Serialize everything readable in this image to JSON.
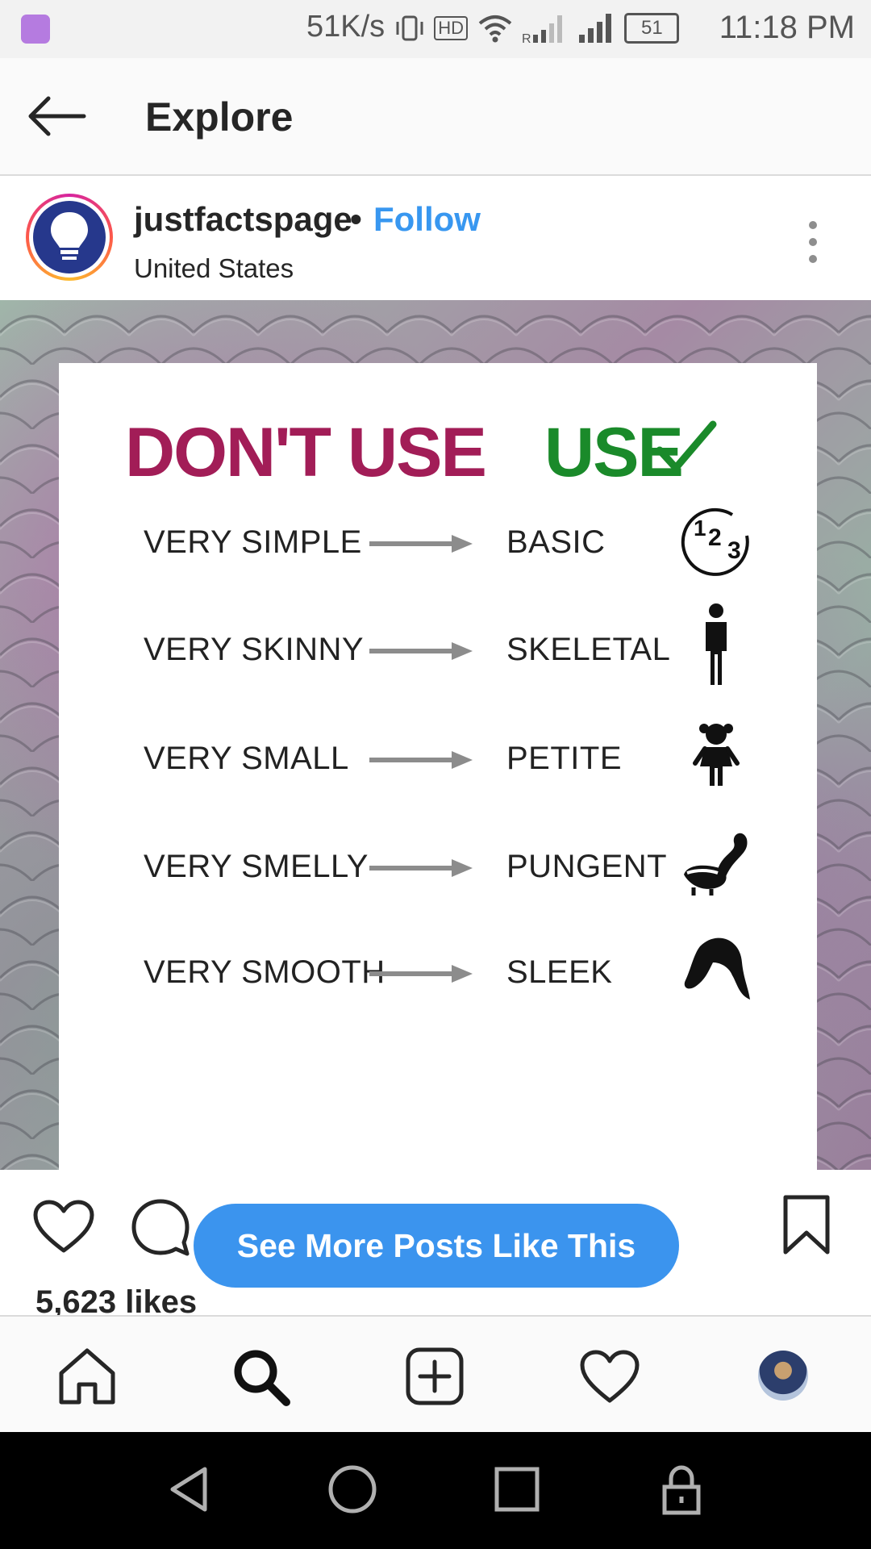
{
  "status_bar": {
    "network_speed": "51K/s",
    "hd_badge": "HD",
    "battery": "51",
    "time": "11:18 PM"
  },
  "header": {
    "title": "Explore",
    "back_icon": "arrow-left-icon"
  },
  "post": {
    "username": "justfactspage",
    "separator": "•",
    "follow_label": "Follow",
    "location": "United States",
    "image": {
      "dont_heading": "DON'T USE",
      "use_heading": "USE",
      "rows": [
        {
          "dont": "VERY SIMPLE",
          "use": "BASIC",
          "icon": "numbers-123-icon"
        },
        {
          "dont": "VERY SKINNY",
          "use": "SKELETAL",
          "icon": "person-icon"
        },
        {
          "dont": "VERY SMALL",
          "use": "PETITE",
          "icon": "girl-icon"
        },
        {
          "dont": "VERY SMELLY",
          "use": "PUNGENT",
          "icon": "skunk-icon"
        },
        {
          "dont": "VERY SMOOTH",
          "use": "SLEEK",
          "icon": "hair-icon"
        }
      ]
    },
    "see_more_label": "See More Posts Like This",
    "likes": "5,623 likes"
  },
  "colors": {
    "follow": "#3897f0",
    "see_more_button": "#3b94ee",
    "dont_heading": "#a21d57",
    "use_heading": "#1a8a2a"
  },
  "bottom_nav": [
    "home-icon",
    "search-icon",
    "add-post-icon",
    "activity-heart-icon",
    "profile-avatar"
  ],
  "system_nav": [
    "back-triangle-icon",
    "home-circle-icon",
    "recents-square-icon",
    "lock-icon"
  ]
}
